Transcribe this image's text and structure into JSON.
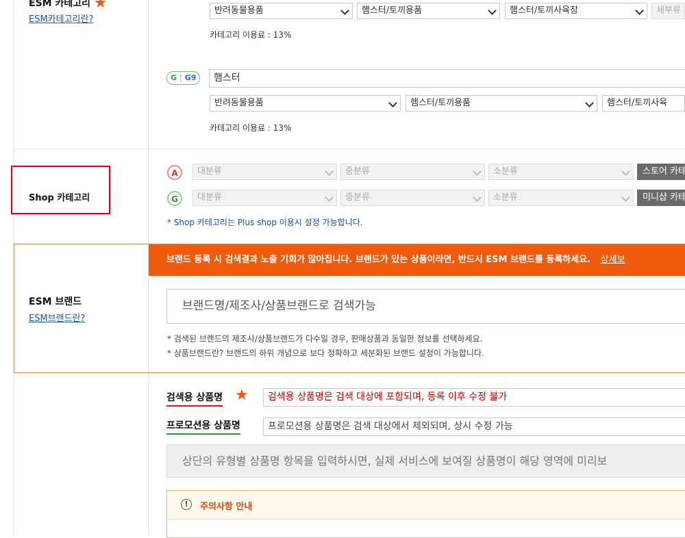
{
  "esm_category": {
    "title": "ESM 카테고리",
    "help_link": "ESM카테고리란?",
    "auction_row": {
      "selects": [
        "반려동물용품",
        "햄스터/토끼용품",
        "햄스터/토끼사육장",
        "세부류"
      ],
      "fee_text": "카테고리 이용료 : 13%"
    },
    "gmarket_row": {
      "badge_g": "G",
      "badge_g9": "G9",
      "search_value": "햄스터",
      "selects": [
        "반려동물용품",
        "햄스터/토끼용품",
        "햄스터/토끼사육"
      ],
      "fee_text": "카테고리 이용료 : 13%"
    }
  },
  "shop_category": {
    "title": "Shop 카테고리",
    "auction_row": {
      "badge": "A",
      "selects": [
        "대분류",
        "중분류",
        "소분류"
      ],
      "button": "스토어 카테"
    },
    "gmarket_row": {
      "badge": "G",
      "selects": [
        "대분류",
        "중분류",
        "소분류"
      ],
      "button": "미니샵 카테"
    },
    "note": "* Shop 카테고리는 Plus shop 이용시 설정 가능합니다."
  },
  "esm_brand": {
    "title": "ESM 브랜드",
    "help_link": "ESM브랜드란?",
    "banner_text": "브랜드 등록 시 검색결과 노출 기회가 많아집니다. 브랜드가 있는 상품이라면, 반드시 ESM 브랜드를 등록하세요.",
    "banner_link": "상세보",
    "search_placeholder": "브랜드명/제조사/상품브랜드로 검색가능",
    "notes": [
      "* 검색된 브랜드의 제조사/상품브랜드가 다수일 경우, 판매상품과 동일한 정보를 선택하세요.",
      "* 상품브랜드란? 브랜드의 하위 개념으로 보다 정확하고 세분화된 브랜드 설정이 가능합니다."
    ]
  },
  "product_name": {
    "search_label": "검색용 상품명",
    "search_placeholder": "검색용 상품명은 검색 대상에 포함되며, 등록 이후 수정 불가",
    "promo_label": "프로모션용 상품명",
    "promo_placeholder": "프로모션용 상품명은 검색 대상에서 제외되며, 상시 수정 가능",
    "preview_text": "상단의 유형별 상품명 항목을 입력하시면, 실제 서비스에 보여질 상품명이 해당 영역에 미리보",
    "notice_title": "주의사항 안내"
  },
  "colors": {
    "brand_orange": "#ef5b0c",
    "highlight_red": "#e0000f",
    "star": "#ef5b0c"
  }
}
